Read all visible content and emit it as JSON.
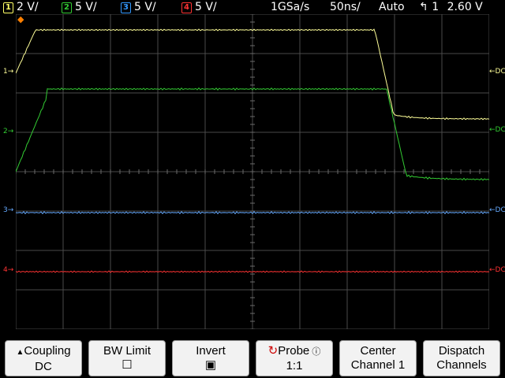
{
  "status_bar": {
    "ch1": {
      "num": "1",
      "scale": "2 V/",
      "color": "#ffff66"
    },
    "ch2": {
      "num": "2",
      "scale": "5 V/",
      "color": "#33cc33"
    },
    "ch3": {
      "num": "3",
      "scale": "5 V/",
      "color": "#3399ff"
    },
    "ch4": {
      "num": "4",
      "scale": "5 V/",
      "color": "#ff3333"
    },
    "sample_rate": "1GSa/s",
    "time_scale": "50ns/",
    "trigger_mode": "Auto",
    "trigger_source": "1",
    "trigger_level": "2.60 V"
  },
  "markers": {
    "ch1": "1",
    "ch2": "2",
    "ch3": "3",
    "ch4": "4",
    "dc_label": "DC"
  },
  "softkeys": [
    {
      "line1": "Coupling",
      "line2": "DC",
      "icon": "up-arrow-icon"
    },
    {
      "line1": "BW Limit",
      "line2": "☐",
      "icon": "checkbox-icon"
    },
    {
      "line1": "Invert",
      "line2": "▣",
      "icon": "checkbox-checked-icon"
    },
    {
      "line1": "Probe",
      "line2": "1:1",
      "icon": "refresh-icon"
    },
    {
      "line1": "Center",
      "line2": "Channel 1"
    },
    {
      "line1": "Dispatch",
      "line2": "Channels"
    }
  ],
  "colors": {
    "grid": "#4a4a4a",
    "ch1": "#ffff99",
    "ch2": "#33cc33",
    "ch3": "#66aaff",
    "ch4": "#ff3333"
  }
}
